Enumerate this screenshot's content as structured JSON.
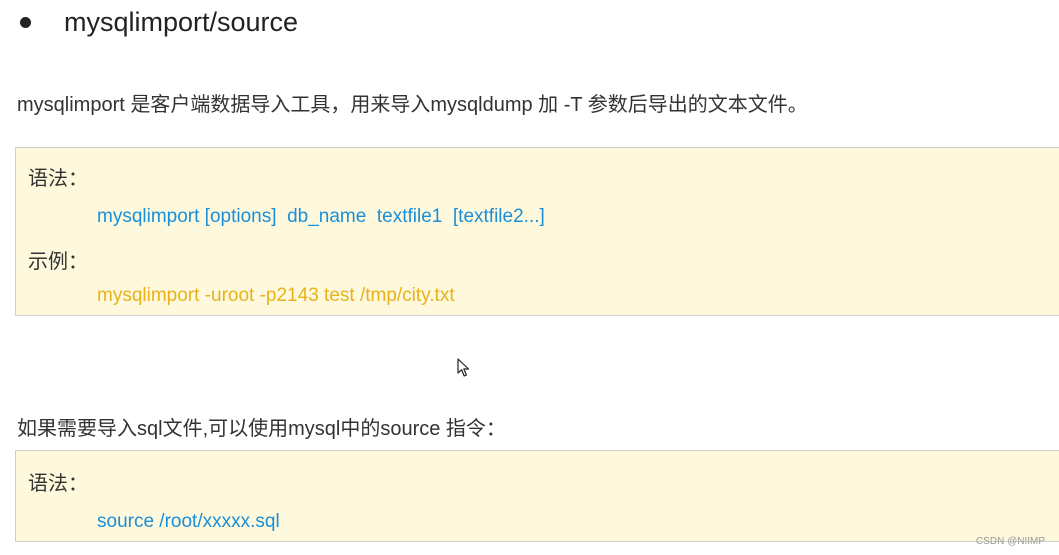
{
  "heading": "mysqlimport/source",
  "intro_text": "mysqlimport 是客户端数据导入工具，用来导入mysqldump 加 -T 参数后导出的文本文件。",
  "box1": {
    "syntax_label": "语法：",
    "syntax_code": "mysqlimport [options]  db_name  textfile1  [textfile2...]",
    "example_label": "示例：",
    "example_code": "mysqlimport -uroot -p2143 test /tmp/city.txt"
  },
  "source_intro": "如果需要导入sql文件,可以使用mysql中的source 指令：",
  "box2": {
    "syntax_label": "语法：",
    "syntax_code": "source /root/xxxxx.sql"
  },
  "watermark": "CSDN @NIIMP",
  "colors": {
    "code_blue": "#1a8fd8",
    "code_yellow": "#e8b21b",
    "box_background": "#fef9dc"
  },
  "icons": {
    "cursor": "mouse-pointer-icon"
  }
}
